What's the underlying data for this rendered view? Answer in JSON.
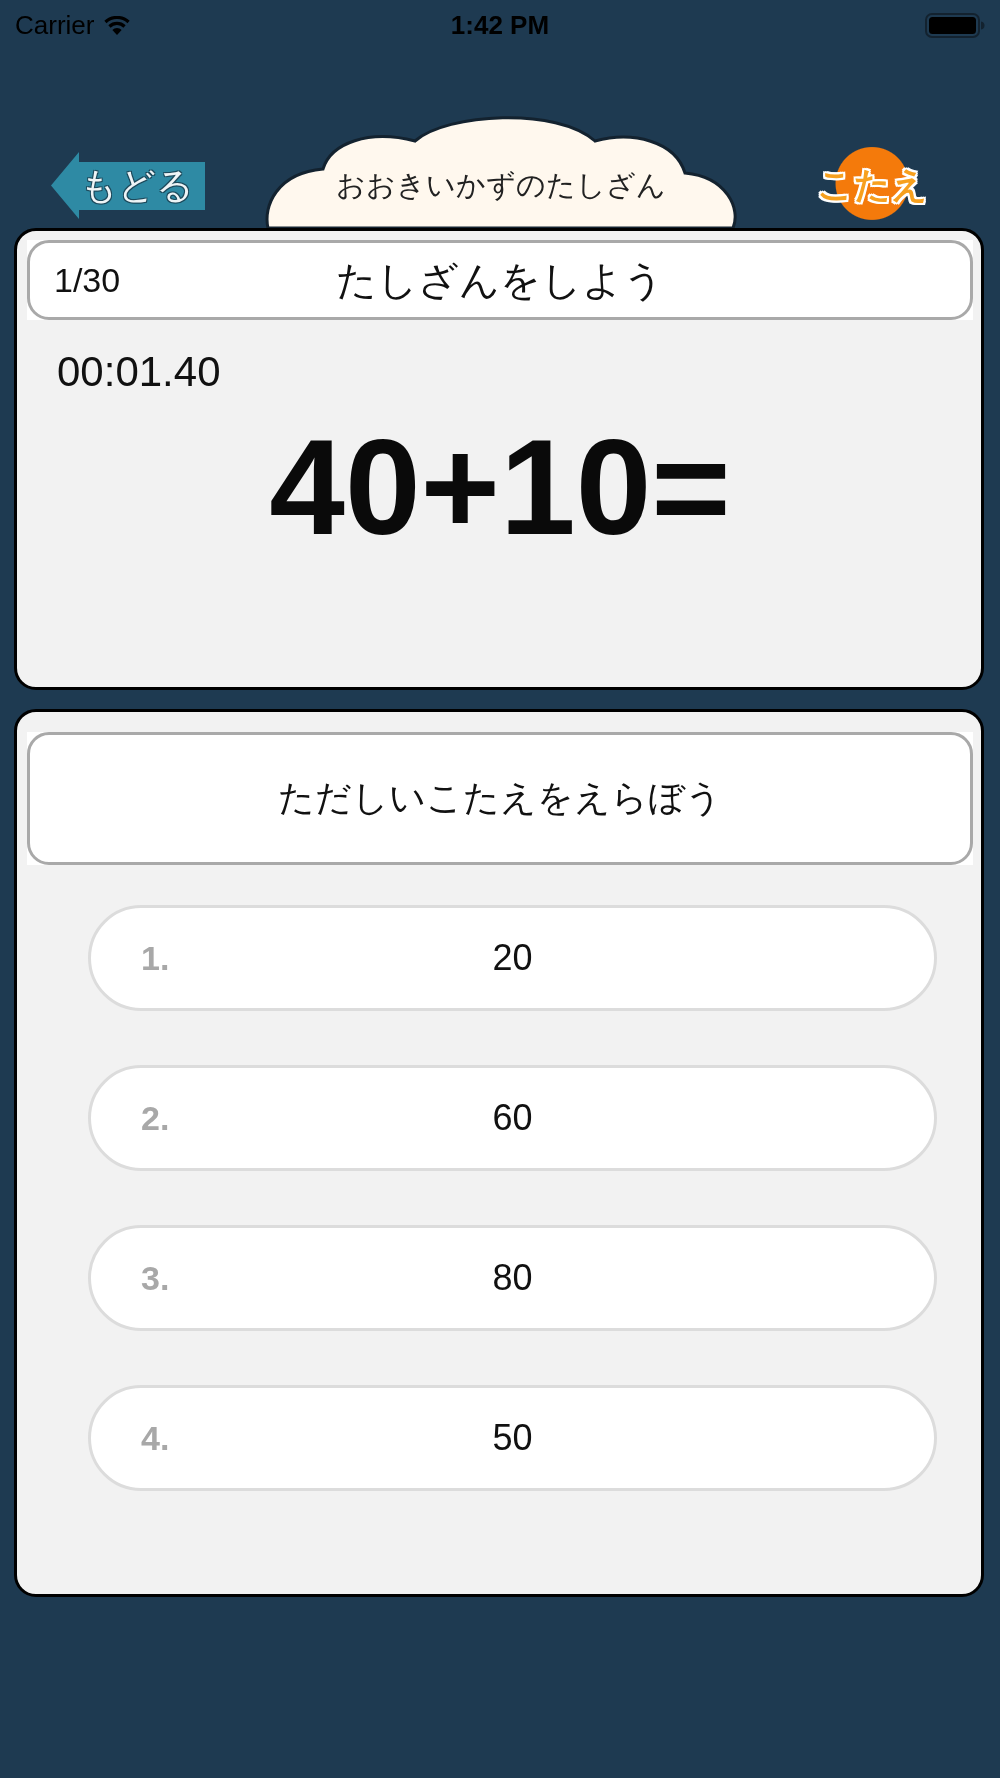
{
  "status_bar": {
    "carrier": "Carrier",
    "time": "1:42 PM"
  },
  "header": {
    "back_button": "もどる",
    "title": "おおきいかずのたしざん",
    "answer_button": "こたえ"
  },
  "question_panel": {
    "counter": "1/30",
    "heading": "たしざんをしよう",
    "timer": "00:01.40",
    "problem": "40+10="
  },
  "answer_panel": {
    "prompt": "ただしいこたえをえらぼう",
    "choices": [
      {
        "number": "1.",
        "value": "20",
        "selected": false
      },
      {
        "number": "2.",
        "value": "60",
        "selected": false
      },
      {
        "number": "3.",
        "value": "80",
        "selected": false
      },
      {
        "number": "4.",
        "value": "50",
        "selected": false
      }
    ]
  }
}
